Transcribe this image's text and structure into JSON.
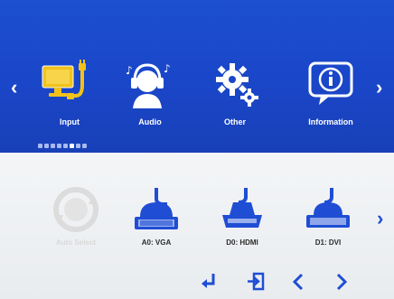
{
  "colors": {
    "top_panel": "#1a46c8",
    "bottom_panel": "#eef0f2",
    "selected_icon": "#f2c21b",
    "accent_blue": "#1f4ed4"
  },
  "menu_tabs": [
    {
      "label": "Input",
      "icon": "monitor-input-icon",
      "selected": true
    },
    {
      "label": "Audio",
      "icon": "headset-icon",
      "selected": false
    },
    {
      "label": "Other",
      "icon": "gear-icon",
      "selected": false
    },
    {
      "label": "Information",
      "icon": "info-icon",
      "selected": false
    }
  ],
  "page_indicator": {
    "total": 8,
    "active_index": 5
  },
  "input_options": [
    {
      "label": "Auto Select",
      "icon": "auto-select-icon",
      "enabled": false
    },
    {
      "label": "A0: VGA",
      "icon": "vga-cable-icon",
      "enabled": true
    },
    {
      "label": "D0: HDMI",
      "icon": "hdmi-cable-icon",
      "enabled": true
    },
    {
      "label": "D1: DVI",
      "icon": "dvi-cable-icon",
      "enabled": true
    }
  ],
  "nav_buttons": [
    {
      "icon": "enter-icon"
    },
    {
      "icon": "exit-icon"
    },
    {
      "icon": "chevron-left-icon"
    },
    {
      "icon": "chevron-right-icon"
    }
  ]
}
